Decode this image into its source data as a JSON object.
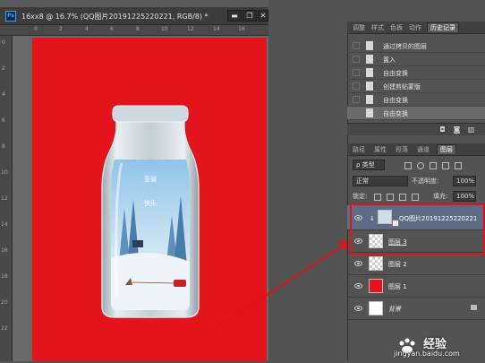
{
  "document": {
    "title": "16xx8 @ 16.7% (QQ图片20191225220221, RGB/8) *",
    "app_icon": "Ps",
    "ruler_top_ticks": [
      "0",
      "2",
      "4",
      "6",
      "8",
      "10",
      "12",
      "14",
      "16"
    ],
    "ruler_left_ticks": [
      "0",
      "2",
      "4",
      "6",
      "8",
      "10",
      "12",
      "14",
      "16",
      "18",
      "20",
      "22"
    ],
    "canvas_background": "#e3141c",
    "bottle_text_line1": "圣诞",
    "bottle_text_line2": "快乐"
  },
  "window_controls": {
    "minimize": "▬",
    "restore": "❐",
    "close": "✕"
  },
  "history_panel": {
    "tabs": [
      "调整",
      "样式",
      "色板",
      "动作",
      "历史记录"
    ],
    "active_tab": "历史记录",
    "items": [
      {
        "label": "通过拷贝的图层"
      },
      {
        "label": "置入"
      },
      {
        "label": "自由变换"
      },
      {
        "label": "创建剪贴蒙版"
      },
      {
        "label": "自由变换"
      },
      {
        "label": "自由变换",
        "active": true
      }
    ]
  },
  "layers_panel": {
    "tabs": [
      "路径",
      "属性",
      "段落",
      "通道",
      "图层"
    ],
    "active_tab": "图层",
    "filter_label": "ρ 类型",
    "blend_mode": "正常",
    "opacity_label": "不透明度:",
    "opacity_value": "100%",
    "lock_label": "锁定:",
    "fill_label": "填充:",
    "fill_value": "100%",
    "layers": [
      {
        "name": "QQ图片20191225220221",
        "kind": "image",
        "selected": true
      },
      {
        "name": "图层 3",
        "kind": "transparent",
        "underline": true
      },
      {
        "name": "图层 2",
        "kind": "transparent"
      },
      {
        "name": "图层 1",
        "kind": "red"
      },
      {
        "name": "背景",
        "kind": "white",
        "locked": true
      }
    ]
  },
  "watermark": {
    "logo_text": "Bai",
    "name": "经验",
    "url": "jingyan.baidu.com"
  },
  "colors": {
    "accent_red": "#e01414",
    "panel_bg": "#535353",
    "selected_row": "#5d6b86"
  }
}
